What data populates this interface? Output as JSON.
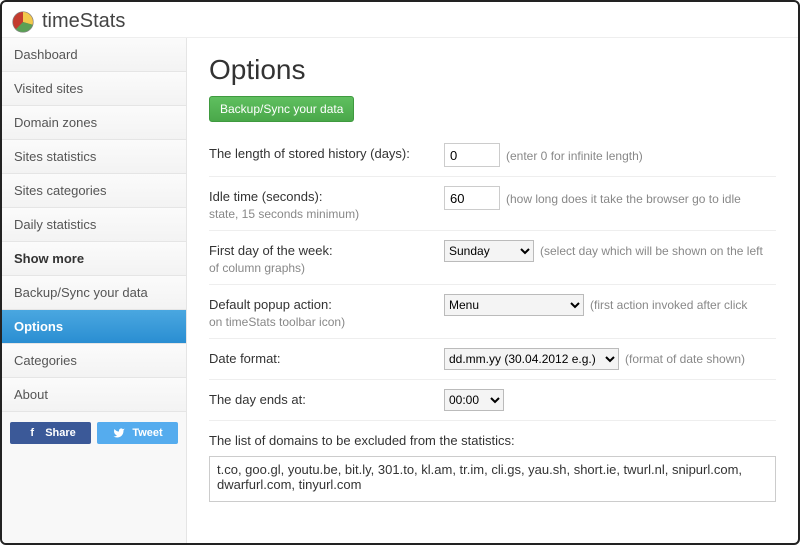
{
  "app": {
    "title": "timeStats"
  },
  "sidebar": {
    "items": [
      {
        "label": "Dashboard"
      },
      {
        "label": "Visited sites"
      },
      {
        "label": "Domain zones"
      },
      {
        "label": "Sites statistics"
      },
      {
        "label": "Sites categories"
      },
      {
        "label": "Daily statistics"
      },
      {
        "label": "Show more"
      },
      {
        "label": "Backup/Sync your data"
      },
      {
        "label": "Options"
      },
      {
        "label": "Categories"
      },
      {
        "label": "About"
      }
    ],
    "social": {
      "share": "Share",
      "tweet": "Tweet"
    }
  },
  "page": {
    "title": "Options",
    "backup_btn": "Backup/Sync your data",
    "history": {
      "label": "The length of stored history (days):",
      "value": "0",
      "hint": "(enter 0 for infinite length)"
    },
    "idle": {
      "label": "Idle time (seconds):",
      "value": "60",
      "hint_pre": "(how long does it take the browser go to idle",
      "hint_post": "state, 15 seconds minimum)"
    },
    "firstday": {
      "label": "First day of the week:",
      "value": "Sunday",
      "hint_pre": "(select day which will be shown on the left",
      "hint_post": "of column graphs)"
    },
    "popup": {
      "label": "Default popup action:",
      "value": "Menu",
      "hint_pre": "(first action invoked after click",
      "hint_post": "on timeStats toolbar icon)"
    },
    "dateformat": {
      "label": "Date format:",
      "value": "dd.mm.yy (30.04.2012 e.g.)",
      "hint": "(format of date shown)"
    },
    "dayend": {
      "label": "The day ends at:",
      "value": "00:00"
    },
    "excluded": {
      "label": "The list of domains to be excluded from the statistics:",
      "value": "t.co, goo.gl, youtu.be, bit.ly, 301.to, kl.am, tr.im, cli.gs, yau.sh, short.ie, twurl.nl, snipurl.com, dwarfurl.com, tinyurl.com"
    }
  }
}
